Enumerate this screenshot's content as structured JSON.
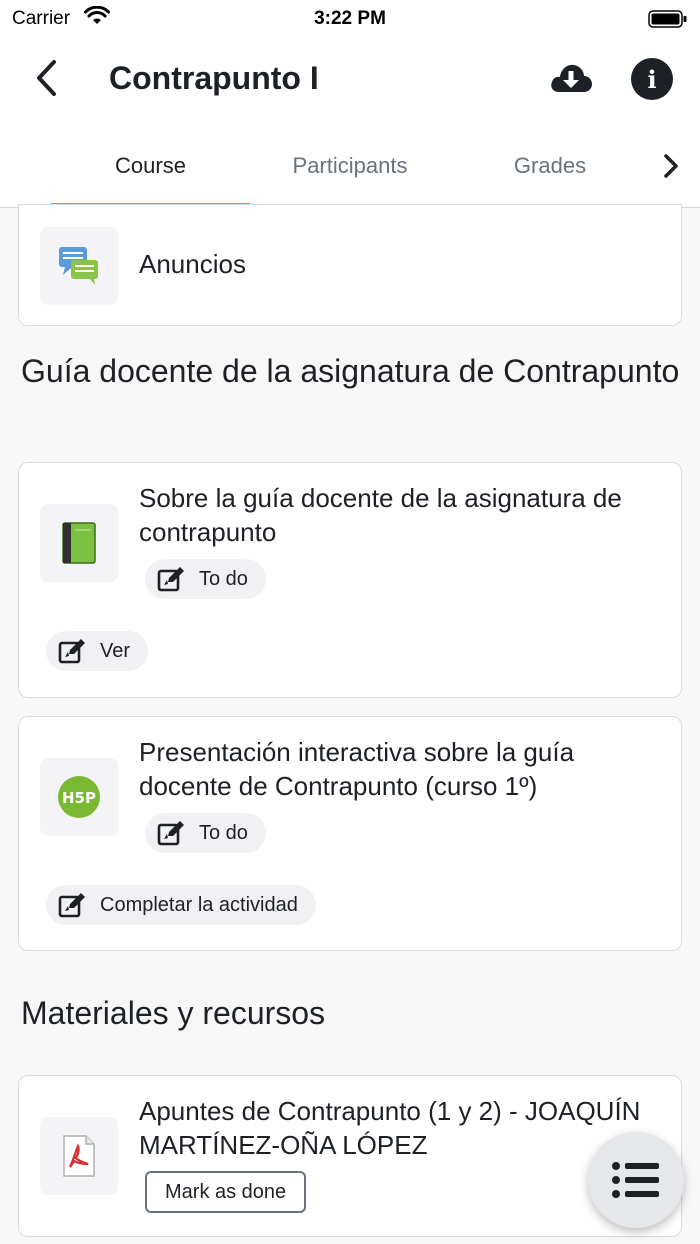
{
  "status_bar": {
    "carrier": "Carrier",
    "time": "3:22 PM"
  },
  "header": {
    "title": "Contrapunto I",
    "back_icon": "chevron-left-icon",
    "download_icon": "cloud-download-icon",
    "info_icon": "info-icon",
    "info_glyph": "i"
  },
  "tabs": [
    {
      "label": "Course",
      "active": true
    },
    {
      "label": "Participants",
      "active": false
    },
    {
      "label": "Grades",
      "active": false
    }
  ],
  "colors": {
    "accent": "#f98012",
    "text": "#1d2125",
    "muted": "#6a737b"
  },
  "forum": {
    "name": "Anuncios",
    "icon": "forum-icon"
  },
  "sections": [
    {
      "title": "Guía docente de la asignatura de Contrapunto",
      "modules": [
        {
          "name": "Sobre la guía docente de la asignatura de contrapunto",
          "icon": "book-icon",
          "status": "To do",
          "action": "Ver"
        },
        {
          "name": "Presentación interactiva sobre la guía docente de Contrapunto (curso 1º)",
          "icon": "h5p-icon",
          "status": "To do",
          "action": "Completar la actividad"
        }
      ]
    },
    {
      "title": "Materiales y recursos",
      "modules": [
        {
          "name": "Apuntes de Contrapunto (1 y 2) - JOAQUÍN MARTÍNEZ-OÑA LÓPEZ",
          "icon": "pdf-icon",
          "button": "Mark as done"
        }
      ]
    }
  ],
  "fab": {
    "icon": "course-index-icon"
  }
}
